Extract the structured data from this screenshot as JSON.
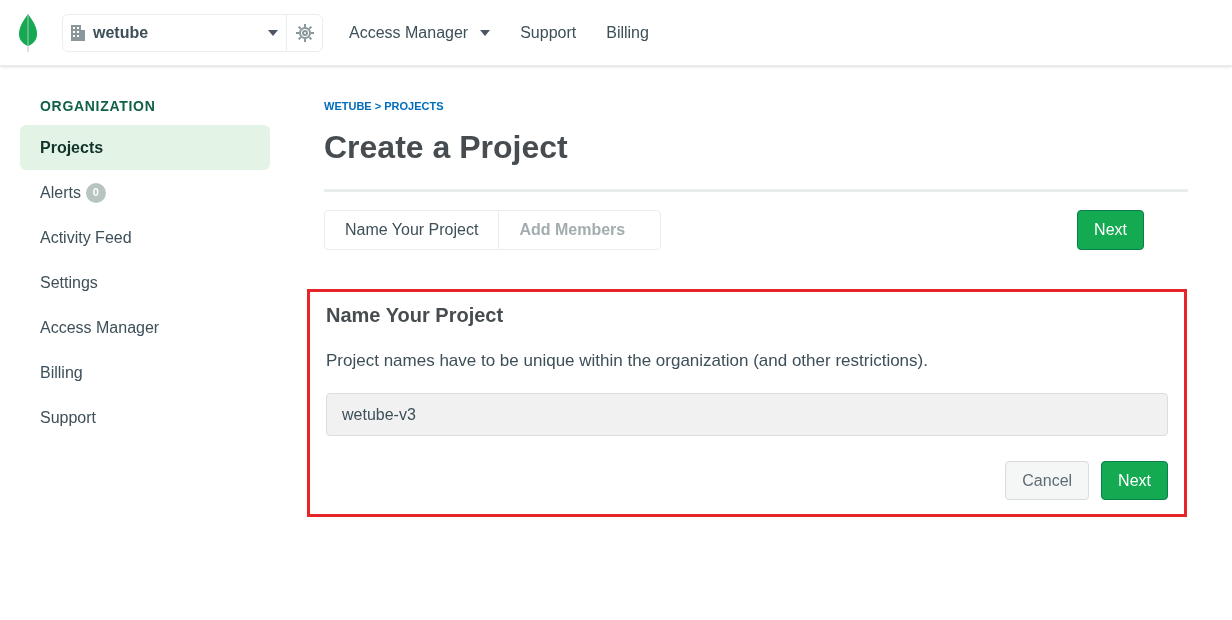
{
  "topbar": {
    "org_selector": {
      "value": "wetube"
    },
    "nav": [
      {
        "label": "Access Manager",
        "has_menu": true
      },
      {
        "label": "Support",
        "has_menu": false
      },
      {
        "label": "Billing",
        "has_menu": false
      }
    ]
  },
  "sidebar": {
    "heading": "ORGANIZATION",
    "items": [
      {
        "label": "Projects",
        "selected": true
      },
      {
        "label": "Alerts",
        "selected": false,
        "badge": "0"
      },
      {
        "label": "Activity Feed",
        "selected": false
      },
      {
        "label": "Settings",
        "selected": false
      },
      {
        "label": "Access Manager",
        "selected": false
      },
      {
        "label": "Billing",
        "selected": false
      },
      {
        "label": "Support",
        "selected": false
      }
    ]
  },
  "breadcrumb": "WETUBE > PROJECTS",
  "title": "Create a Project",
  "steps": [
    {
      "label": "Name Your Project",
      "selected": true
    },
    {
      "label": "Add Members",
      "selected": false
    }
  ],
  "top_next": "Next",
  "form": {
    "highlighted": true,
    "heading": "Name Your Project",
    "description": "Project names have to be unique within the organization (and other restrictions).",
    "project_name": {
      "value": "wetube-v3"
    },
    "buttons": [
      {
        "label": "Cancel",
        "kind": "secondary"
      },
      {
        "label": "Next",
        "kind": "primary"
      }
    ]
  }
}
